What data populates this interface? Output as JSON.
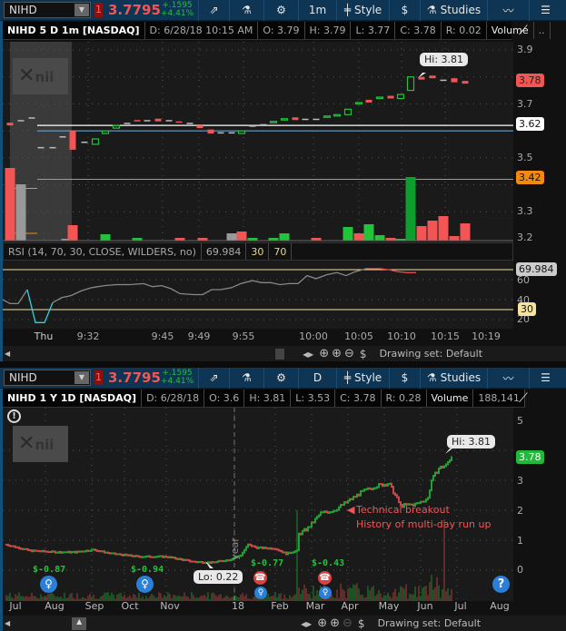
{
  "top": {
    "toolbar": {
      "symbol": "NIHD",
      "badge": "1",
      "last": "3.7795",
      "change": "+.1595",
      "change_pct": "+4.41%",
      "aggregation": "1m",
      "style": "Style",
      "studies": "Studies"
    },
    "header": {
      "title": "NIHD 5 D 1m [NASDAQ]",
      "date": "D: 6/28/18 10:15 AM",
      "open": "O: 3.79",
      "high": "H: 3.79",
      "low": "L: 3.77",
      "close": "C: 3.78",
      "range": "R: 0.02",
      "volume_label": "Volume",
      "more": ".."
    },
    "price_axis": [
      "3.9",
      "3.8",
      "3.7",
      "3.6",
      "3.5",
      "3.4",
      "3.3",
      "3.2"
    ],
    "tags": {
      "last": "3.78",
      "level1": "3.62",
      "level2": "3.42"
    },
    "hi_label": "Hi: 3.81",
    "logo": "nii",
    "rsi": {
      "label": "RSI (14, 70, 30, CLOSE, WILDERS, no)",
      "value": "69.984",
      "ob": "30",
      "os": "70",
      "axis": [
        "60",
        "40",
        "20"
      ],
      "tag_value": "69.984",
      "tag_30": "30"
    },
    "time_axis": [
      "Thu",
      "9:32",
      "9:45",
      "9:49",
      "9:55",
      "10:00",
      "10:05",
      "10:10",
      "10:15",
      "10:19"
    ],
    "drawing_set": "Drawing set: Default"
  },
  "bottom": {
    "toolbar": {
      "symbol": "NIHD",
      "badge": "1",
      "last": "3.7795",
      "change": "+.1595",
      "change_pct": "+4.41%",
      "aggregation": "D",
      "style": "Style",
      "studies": "Studies"
    },
    "header": {
      "title": "NIHD 1 Y 1D [NASDAQ]",
      "date": "D: 6/28/18",
      "open": "O: 3.6",
      "high": "H: 3.81",
      "low": "L: 3.53",
      "close": "C: 3.78",
      "range": "R: 0.28",
      "volume_label": "Volume",
      "volume": "188,141"
    },
    "price_axis": [
      "5",
      "3",
      "2",
      "1",
      "0"
    ],
    "tags": {
      "last": "3.78"
    },
    "hi_label": "Hi: 3.81",
    "lo_label": "Lo: 0.22",
    "logo": "nii",
    "year_marker": "year",
    "events": {
      "e1": "$-0.87",
      "e2": "$-0.94",
      "e3": "$-0.77",
      "e4": "$-0.43"
    },
    "annotations": [
      "Technical breakout",
      "History of multi-day run up"
    ],
    "time_axis": [
      "Jul",
      "Aug",
      "Sep",
      "Oct",
      "Nov",
      "18",
      "Feb",
      "Mar",
      "Apr",
      "May",
      "Jun",
      "Jul",
      "Aug"
    ],
    "drawing_set": "Drawing set: Default"
  },
  "colors": {
    "up": "#22c33a",
    "down": "#f35555",
    "bg": "#1a1a1a",
    "toolbar": "#0e3554"
  }
}
